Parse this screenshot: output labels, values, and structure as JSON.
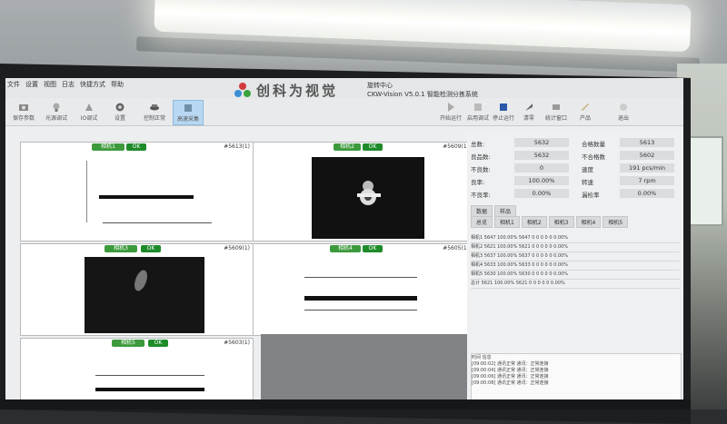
{
  "menu": [
    "文件",
    "设置",
    "视图",
    "日志",
    "快捷方式",
    "帮助"
  ],
  "brand": {
    "name": "创科为视觉",
    "sub_line1": "旋转中心",
    "sub_line2": "CKW-Vision V5.0.1 智能检测分拣系统"
  },
  "toolbar_left": [
    {
      "label": "保存参数",
      "icon": "camera-icon"
    },
    {
      "label": "光源调试",
      "icon": "light-icon"
    },
    {
      "label": "IO调试",
      "icon": "io-icon"
    },
    {
      "label": "设置",
      "icon": "gear-icon"
    },
    {
      "label": "控制正常",
      "icon": "control-icon"
    },
    {
      "label": "高速采集",
      "icon": "capture-icon"
    }
  ],
  "toolbar_right": [
    {
      "label": "开始运行",
      "icon": "play-icon"
    },
    {
      "label": "启用调试",
      "icon": "debug-icon"
    },
    {
      "label": "停止运行",
      "icon": "stop-icon"
    },
    {
      "label": "清零",
      "icon": "clear-icon"
    },
    {
      "label": "统计窗口",
      "icon": "stats-icon"
    },
    {
      "label": "产品",
      "icon": "product-icon"
    },
    {
      "label": "退出",
      "icon": "exit-icon"
    }
  ],
  "cells": [
    {
      "name": "相机1",
      "status": "OK",
      "count": "#5613(1)"
    },
    {
      "name": "相机2",
      "status": "OK",
      "count": "#5609(1)"
    },
    {
      "name": "相机3",
      "status": "OK",
      "count": "#5609(1)"
    },
    {
      "name": "相机4",
      "status": "OK",
      "count": "#5605(1)"
    },
    {
      "name": "相机5",
      "status": "OK",
      "count": "#5603(1)"
    }
  ],
  "stats": [
    {
      "label": "总数:",
      "value": "5632",
      "label2": "合格数量",
      "value2": "5613"
    },
    {
      "label": "良品数:",
      "value": "5632",
      "label2": "不合格数",
      "value2": "5602"
    },
    {
      "label": "不良数:",
      "value": "0",
      "label2": "速度",
      "value2": "191 pcs/min"
    },
    {
      "label": "良率:",
      "value": "100.00%",
      "label2": "转速",
      "value2": "7 rpm"
    },
    {
      "label": "不良率:",
      "value": "0.00%",
      "label2": "漏检率",
      "value2": "0.00%"
    }
  ],
  "tabs": [
    "数据",
    "样品"
  ],
  "subtabs": [
    "总览",
    "相机1",
    "相机2",
    "相机3",
    "相机4",
    "相机5"
  ],
  "table_rows": [
    "相机1   5647  100.00%  5647  0  0  0  0  0  0.00%",
    "相机2   5621  100.00%  5621  0  0  0  0  0  0.00%",
    "相机3   5637  100.00%  5637  0  0  0  0  0  0.00%",
    "相机4   5633  100.00%  5633  0  0  0  0  0  0.00%",
    "相机5   5630  100.00%  5630  0  0  0  0  0  0.00%",
    "总计    5621  100.00%  5621  0  0  0  0  0  0.00%"
  ],
  "log": {
    "header": "时间            信息",
    "lines": [
      "[09:00:02]   通讯正常   通讯：正常连接",
      "[09:00:04]   通讯正常   通讯：正常连接",
      "[09:00:06]   通讯正常   通讯：正常连接",
      "[09:00:08]   通讯正常   通讯：正常连接"
    ]
  }
}
